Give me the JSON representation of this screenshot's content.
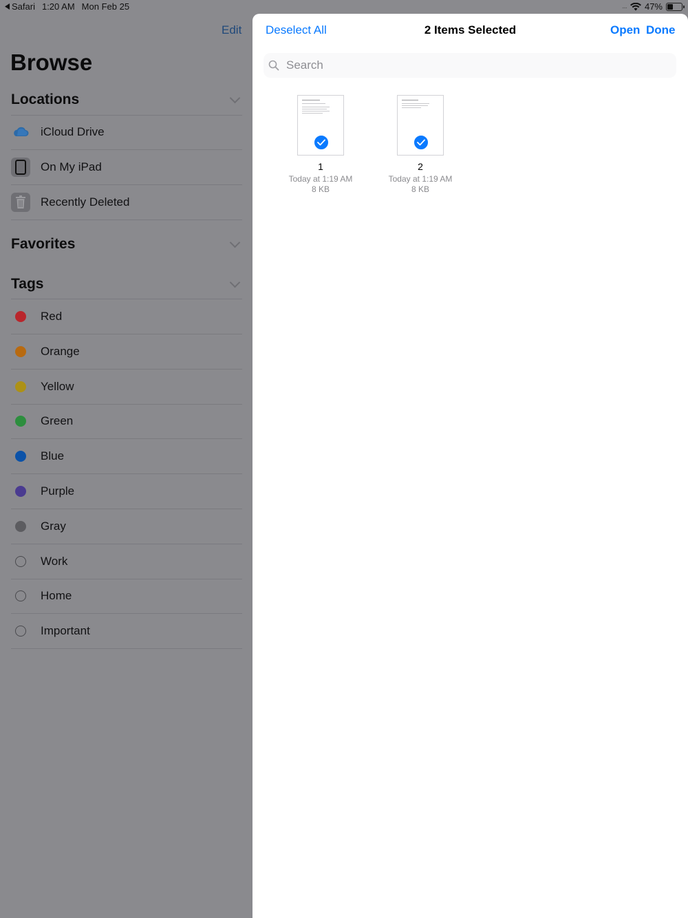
{
  "status_bar": {
    "back_app": "Safari",
    "time": "1:20 AM",
    "date": "Mon Feb 25",
    "battery": "47%",
    "battery_level": 0.47
  },
  "sidebar": {
    "edit_label": "Edit",
    "title": "Browse",
    "locations": {
      "header": "Locations",
      "items": [
        {
          "label": "iCloud Drive",
          "icon": "icloud-icon"
        },
        {
          "label": "On My iPad",
          "icon": "ipad-icon"
        },
        {
          "label": "Recently Deleted",
          "icon": "trash-icon"
        }
      ]
    },
    "favorites": {
      "header": "Favorites"
    },
    "tags": {
      "header": "Tags",
      "items": [
        {
          "label": "Red",
          "color": "#b9262c"
        },
        {
          "label": "Orange",
          "color": "#b86a10"
        },
        {
          "label": "Yellow",
          "color": "#ad9116"
        },
        {
          "label": "Green",
          "color": "#2d8e3e"
        },
        {
          "label": "Blue",
          "color": "#0b52a8"
        },
        {
          "label": "Purple",
          "color": "#4a3b90"
        },
        {
          "label": "Gray",
          "color": "#5c5c60"
        },
        {
          "label": "Work",
          "color": ""
        },
        {
          "label": "Home",
          "color": ""
        },
        {
          "label": "Important",
          "color": ""
        }
      ]
    }
  },
  "panel": {
    "deselect_label": "Deselect All",
    "title": "2 Items Selected",
    "open_label": "Open",
    "done_label": "Done",
    "search_placeholder": "Search",
    "files": [
      {
        "name": "1",
        "date": "Today at 1:19 AM",
        "size": "8 KB",
        "selected": true
      },
      {
        "name": "2",
        "date": "Today at 1:19 AM",
        "size": "8 KB",
        "selected": true
      }
    ],
    "accent": "#0a7aff"
  }
}
